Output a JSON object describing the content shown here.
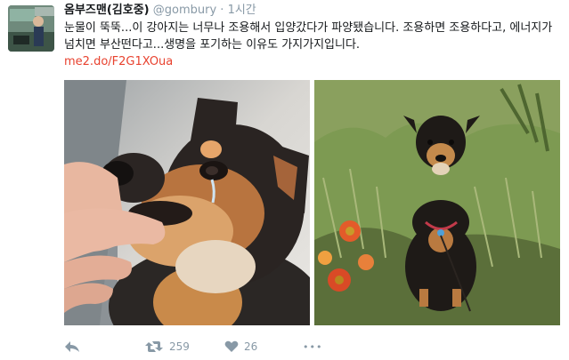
{
  "tweet": {
    "author_name": "옴부즈맨(김호중)",
    "handle": "@gombury",
    "separator": "·",
    "time": "1시간",
    "text": "눈물이 뚝뚝...이 강아지는 너무나 조용해서 입양갔다가 파양됐습니다. 조용하면 조용하다고, 에너지가 넘치면 부산떤다고...생명을 포기하는 이유도 가지가지입니다.",
    "link": "me2.do/F2G1XOua",
    "retweets": "259",
    "likes": "26",
    "more": "•••"
  },
  "icons": [
    "reply-icon",
    "retweet-icon",
    "heart-icon",
    "more-icon"
  ]
}
